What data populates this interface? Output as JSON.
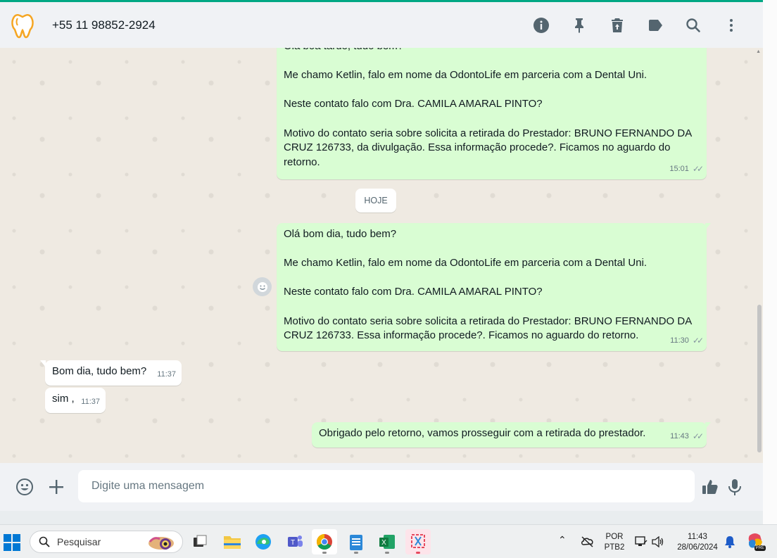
{
  "header": {
    "contact": "+55 11 98852-2924",
    "icons": [
      "info-icon",
      "pin-icon",
      "delete-icon",
      "label-icon",
      "search-icon",
      "menu-icon"
    ]
  },
  "messages": {
    "m1": {
      "text": "Olá boa tarde, tudo bem?\n\nMe chamo Ketlin, falo em nome da OdontoLife em parceria com a Dental Uni.\n\nNeste contato falo com Dra. CAMILA AMARAL PINTO?\n\nMotivo do contato seria sobre solicita a retirada do Prestador: BRUNO FERNANDO DA CRUZ 126733, da divulgação. Essa informação procede?. Ficamos no aguardo do retorno.",
      "time": "15:01"
    },
    "day_chip": "HOJE",
    "m2": {
      "text": "Olá bom dia, tudo bem?\n\nMe chamo Ketlin, falo em nome da OdontoLife em parceria com a Dental Uni.\n\nNeste contato falo com Dra. CAMILA AMARAL PINTO?\n\nMotivo do contato seria sobre solicita a retirada do Prestador: BRUNO FERNANDO DA CRUZ 126733. Essa informação procede?. Ficamos no aguardo do retorno.",
      "time": "11:30"
    },
    "m3": {
      "text": "Bom dia, tudo bem?",
      "time": "11:37"
    },
    "m4": {
      "text": "sim ,",
      "time": "11:37"
    },
    "m5": {
      "text": "Obrigado pelo retorno, vamos prosseguir com a retirada do prestador.",
      "time": "11:43"
    }
  },
  "composer": {
    "placeholder": "Digite uma mensagem"
  },
  "taskbar": {
    "search_label": "Pesquisar",
    "lang_line1": "POR",
    "lang_line2": "PTB2",
    "time": "11:43",
    "date": "28/06/2024",
    "copilot_badge": "PRE"
  },
  "colors": {
    "accent": "#00a884",
    "outgoing_bubble": "#d9fdd3",
    "incoming_bubble": "#ffffff",
    "chat_background": "#efeae2"
  }
}
